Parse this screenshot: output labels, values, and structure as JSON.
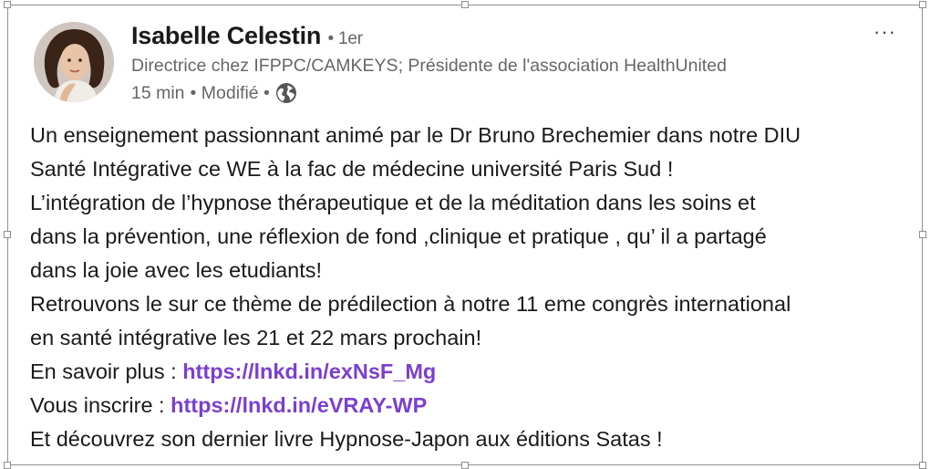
{
  "author": {
    "name": "Isabelle Celestin",
    "degree": "• 1er",
    "headline": "Directrice chez IFPPC/CAMKEYS; Présidente de l'association HealthUnited",
    "time": "15 min",
    "edited": "• Modifié •",
    "visibility_icon": "globe-icon"
  },
  "menu": {
    "label": "···"
  },
  "post": {
    "lines": [
      "Un enseignement passionnant animé par le Dr Bruno Brechemier dans notre DIU",
      "Santé Intégrative ce WE à la fac de médecine université Paris Sud !",
      "L’intégration de l’hypnose thérapeutique et de la méditation dans les soins et",
      "dans la prévention, une réflexion de fond ,clinique et pratique , qu’ il a partagé",
      "dans la joie avec les etudiants!",
      "Retrouvons le sur ce thème de prédilection à notre 11 eme congrès international",
      "en santé intégrative les 21 et 22 mars prochain!"
    ],
    "link1_prefix": "En savoir plus : ",
    "link1": "https://lnkd.in/exNsF_Mg",
    "link2_prefix": "Vous inscrire : ",
    "link2": "https://lnkd.in/eVRAY-WP",
    "last_line": "Et découvrez son dernier livre Hypnose-Japon aux éditions Satas !"
  },
  "colors": {
    "link": "#7b3fcf",
    "text": "#1a1a1a",
    "muted": "#666666"
  }
}
